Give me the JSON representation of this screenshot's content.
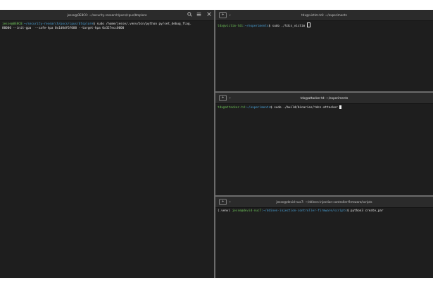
{
  "terminals": {
    "left": {
      "title": "jesse@0E8C0: ~/security-research/pocs/cpus/btsplore",
      "search_icon": "search-icon",
      "menu_icon": "hamburger-menu-icon",
      "close_icon": "close-icon",
      "prompt_user": "jesse@0E8C0",
      "prompt_path": ":~/security-research/pocs/cpus/btsplore",
      "command": "$ sudo /home/jesse/.venv/bin/python py/set_debug_flag.",
      "output_line": "00000 --init-gpa  --safe-hpa 0x1d0df6f000 --target-hpa 0x327ecc0000"
    },
    "top_right": {
      "title": "tdx@victim-tdi: ~/experiments",
      "new_tab_icon": "new-tab-icon",
      "dropdown_icon": "chevron-down-icon",
      "prompt_user": "tdx@victim-tdi",
      "prompt_path": ":~/experiments",
      "command": "$ sudo ./tdcs_victim "
    },
    "middle_right": {
      "title": "tdx@attacker-td: ~/experiments",
      "new_tab_icon": "new-tab-icon",
      "dropdown_icon": "chevron-down-icon",
      "prompt_user": "tdx@attacker-td",
      "prompt_path": ":~/experiments",
      "command": "$ sudo ./build/binaries/tdcs-attacker "
    },
    "bottom_right": {
      "title": "jesse@devid-nuc7: ~/ddinen-injection-controller-firmware/scripts",
      "new_tab_icon": "new-tab-icon",
      "dropdown_icon": "chevron-down-icon",
      "venv": "(.venv) ",
      "prompt_user": "jesse@devid-nuc7",
      "prompt_path": ":~/ddinen-injection-controller-firmware/scripts",
      "command": "$ python3 create_par"
    }
  },
  "colors": {
    "terminal_bg": "#1e1e1e",
    "titlebar_bg": "#2b2b2b",
    "prompt_user": "#6fc55a",
    "prompt_path": "#4aa3d9",
    "text": "#e6e6e6"
  }
}
